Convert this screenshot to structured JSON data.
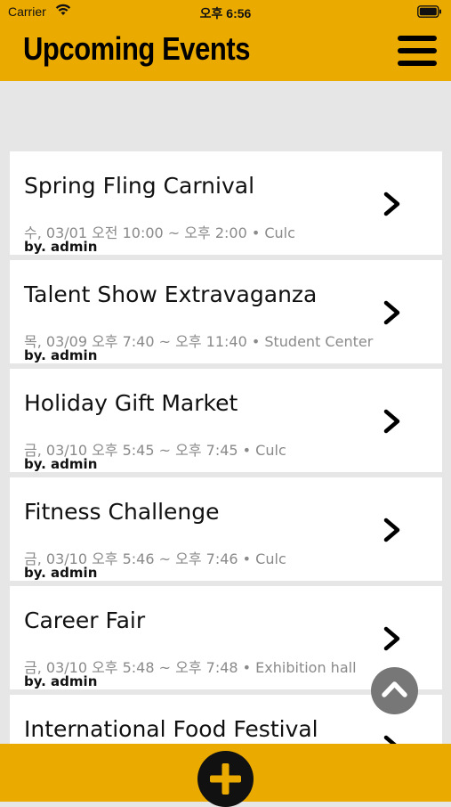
{
  "status_bar": {
    "carrier": "Carrier",
    "time": "오후 6:56",
    "icons": [
      "wifi-icon",
      "battery-icon"
    ]
  },
  "header": {
    "title": "Upcoming Events",
    "menu_icon": "hamburger-menu-icon"
  },
  "colors": {
    "accent": "#eaaa00",
    "background": "#e6e6e6",
    "card": "#ffffff",
    "meta_text": "#8a8a8a",
    "scroll_button": "#777777"
  },
  "events": [
    {
      "title": "Spring Fling Carnival",
      "meta": "수, 03/01 오전 10:00 ~ 오후 2:00 • Culc",
      "author": "by. admin"
    },
    {
      "title": "Talent Show Extravaganza",
      "meta": "목, 03/09 오후 7:40 ~ 오후 11:40 • Student Center",
      "author": "by. admin"
    },
    {
      "title": "Holiday Gift Market",
      "meta": "금, 03/10 오후 5:45 ~ 오후 7:45 • Culc",
      "author": "by. admin"
    },
    {
      "title": "Fitness Challenge",
      "meta": "금, 03/10 오후 5:46 ~ 오후 7:46 • Culc",
      "author": "by. admin"
    },
    {
      "title": "Career Fair",
      "meta": "금, 03/10 오후 5:48 ~ 오후 7:48 • Exhibition hall",
      "author": "by. admin"
    },
    {
      "title": "International Food Festival",
      "meta": "",
      "author": ""
    }
  ],
  "controls": {
    "scroll_top_icon": "chevron-up-icon",
    "add_icon": "plus-icon"
  }
}
